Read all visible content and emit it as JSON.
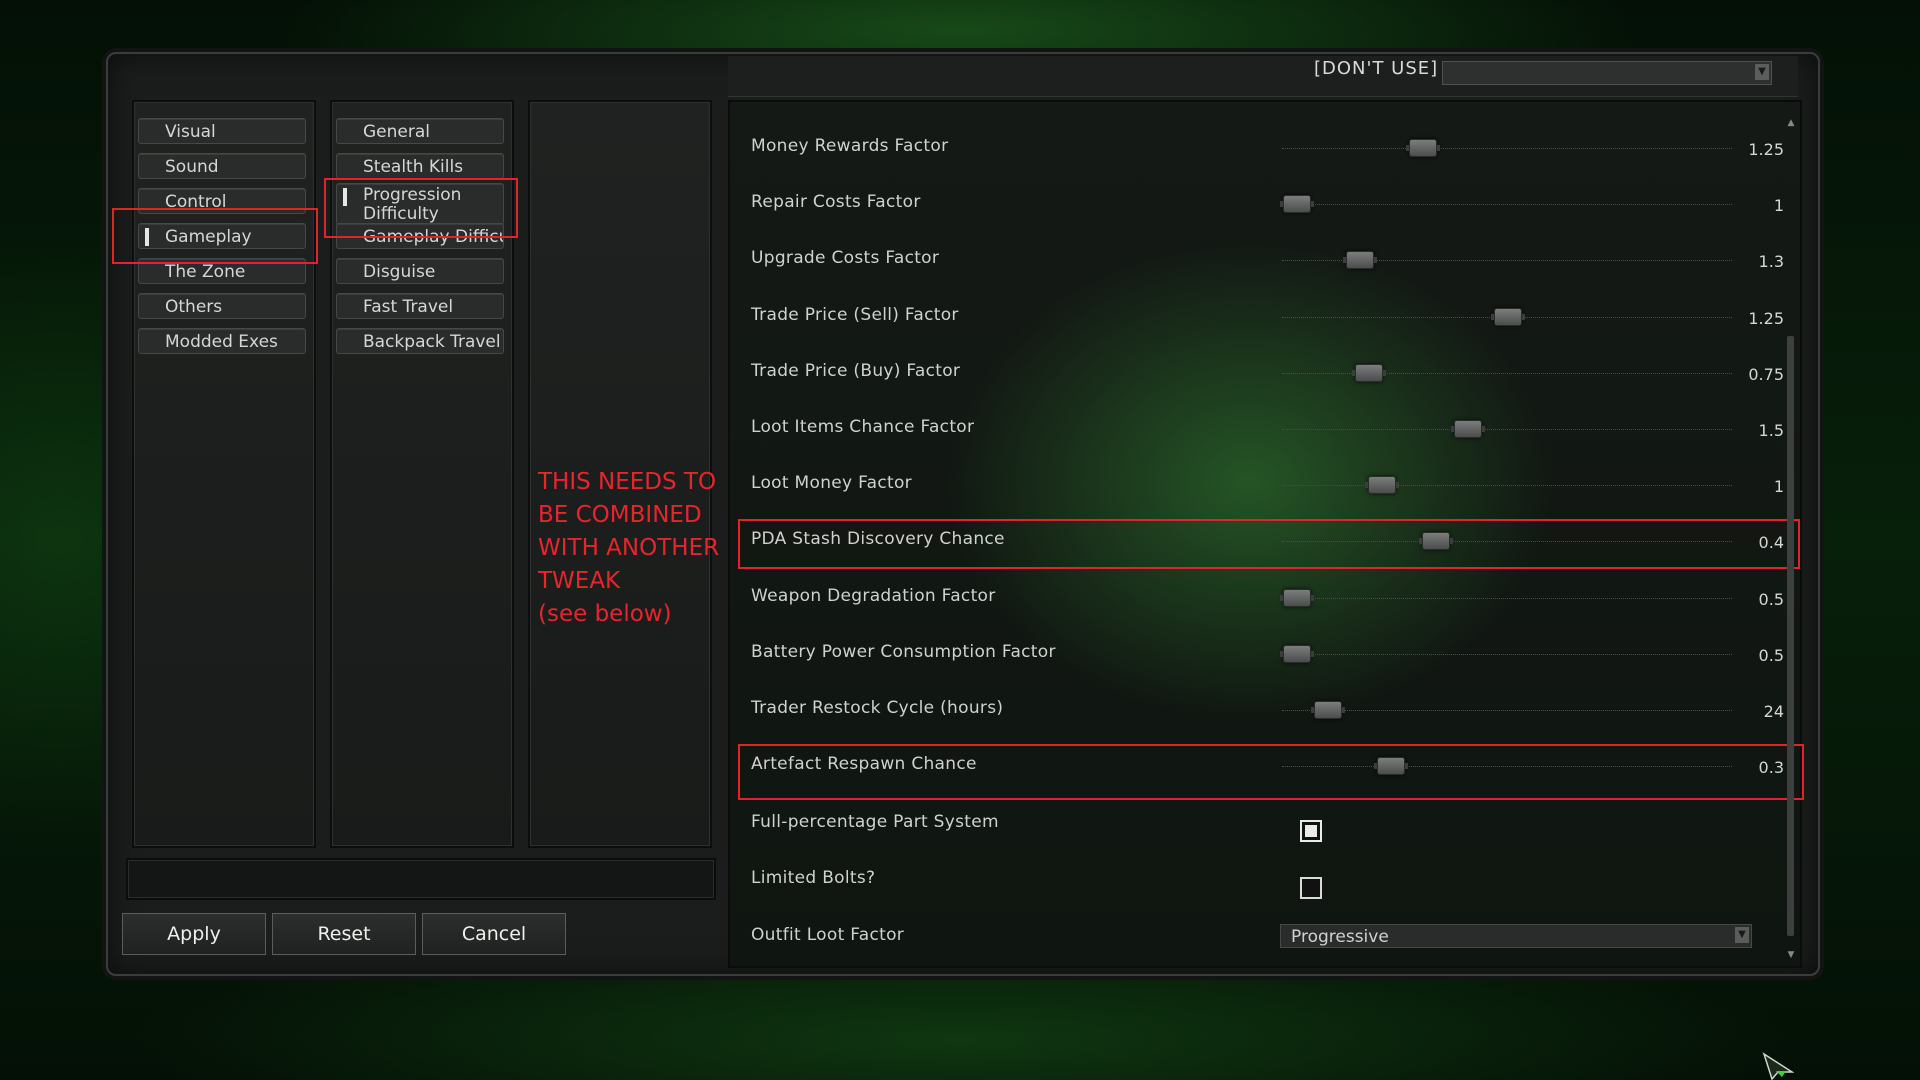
{
  "left_nav": {
    "categories": [
      {
        "label": "Visual"
      },
      {
        "label": "Sound"
      },
      {
        "label": "Control"
      },
      {
        "label": "Gameplay"
      },
      {
        "label": "The Zone"
      },
      {
        "label": "Others"
      },
      {
        "label": "Modded Exes"
      }
    ],
    "selected_category": "Gameplay",
    "subcategories": [
      {
        "label": "General"
      },
      {
        "label": "Stealth Kills"
      },
      {
        "label": "Progression Difficulty"
      },
      {
        "label": "Gameplay Difficulty"
      },
      {
        "label": "Disguise"
      },
      {
        "label": "Fast Travel"
      },
      {
        "label": "Backpack Travel"
      }
    ],
    "selected_subcategory": "Progression Difficulty"
  },
  "annotation": {
    "lines": [
      "THIS NEEDS TO",
      "BE COMBINED",
      "WITH ANOTHER",
      "TWEAK",
      "(see below)"
    ],
    "color": "#e8242c"
  },
  "actions": {
    "apply": "Apply",
    "reset": "Reset",
    "cancel": "Cancel"
  },
  "header": {
    "label": "[DON'T USE]",
    "dropdown_value": ""
  },
  "settings": [
    {
      "label": "Money Rewards Factor",
      "value": "1.25",
      "level": 0.31
    },
    {
      "label": "Repair Costs Factor",
      "value": "1",
      "level": 0.03
    },
    {
      "label": "Upgrade Costs Factor",
      "value": "1.3",
      "level": 0.17
    },
    {
      "label": "Trade Price (Sell) Factor",
      "value": "1.25",
      "level": 0.5
    },
    {
      "label": "Trade Price (Buy) Factor",
      "value": "0.75",
      "level": 0.19
    },
    {
      "label": "Loot Items Chance Factor",
      "value": "1.5",
      "level": 0.41
    },
    {
      "label": "Loot Money Factor",
      "value": "1",
      "level": 0.22
    },
    {
      "label": "PDA Stash Discovery Chance",
      "value": "0.4",
      "level": 0.34,
      "highlighted": true
    },
    {
      "label": "Weapon Degradation Factor",
      "value": "0.5",
      "level": 0.03
    },
    {
      "label": "Battery Power Consumption Factor",
      "value": "0.5",
      "level": 0.03
    },
    {
      "label": "Trader Restock Cycle (hours)",
      "value": "24",
      "level": 0.1
    },
    {
      "label": "Artefact Respawn Chance",
      "value": "0.3",
      "level": 0.24,
      "highlighted": true
    }
  ],
  "checkboxes": [
    {
      "label": "Full-percentage Part System",
      "checked": true
    },
    {
      "label": "Limited Bolts?",
      "checked": false
    }
  ],
  "outfit": {
    "label": "Outfit Loot Factor",
    "value": "Progressive"
  },
  "colors": {
    "highlight": "#e0242a",
    "panel": "#1b1d1c"
  }
}
